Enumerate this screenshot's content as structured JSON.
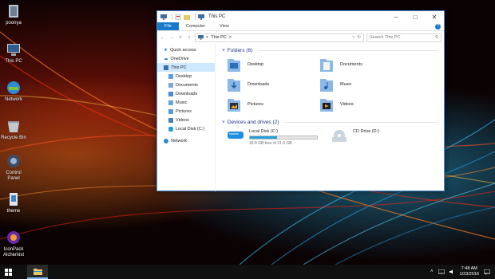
{
  "desktop": {
    "icons": [
      {
        "label": "poonya",
        "icon": "user-folder-icon"
      },
      {
        "label": "This PC",
        "icon": "computer-icon"
      },
      {
        "label": "Network",
        "icon": "network-icon"
      },
      {
        "label": "Recycle Bin",
        "icon": "recycle-bin-icon"
      },
      {
        "label": "Control Panel",
        "icon": "control-panel-icon"
      },
      {
        "label": "theme",
        "icon": "theme-file-icon"
      },
      {
        "label": "IconPack Alchemist",
        "icon": "iconpack-alchemist-icon"
      }
    ]
  },
  "window": {
    "title": "This PC",
    "ribbon_tabs": [
      "File",
      "Computer",
      "View"
    ],
    "help": "?",
    "address": {
      "path": "This PC",
      "sep": ">"
    },
    "search": {
      "placeholder": "Search This PC"
    },
    "nav_pane": {
      "quick_access": "Quick access",
      "onedrive": "OneDrive",
      "this_pc": "This PC",
      "children": [
        "Desktop",
        "Documents",
        "Downloads",
        "Music",
        "Pictures",
        "Videos",
        "Local Disk (C:)"
      ],
      "network": "Network"
    },
    "folders_header": "Folders (6)",
    "folders": [
      "Desktop",
      "Documents",
      "Downloads",
      "Music",
      "Pictures",
      "Videos"
    ],
    "drives_header": "Devices and drives (2)",
    "drives": [
      {
        "name": "Local Disk (C:)",
        "free": "18.8 GB free of 31.5 GB",
        "used_fraction": 0.4
      },
      {
        "name": "CD Drive (D:)"
      }
    ]
  },
  "taskbar": {
    "time": "7:48 AM",
    "date": "1/23/2016"
  },
  "colors": {
    "accent": "#1979ca",
    "selection": "#cde8ff",
    "group_header": "#1e3287",
    "drive_bar": "#26a0da"
  }
}
